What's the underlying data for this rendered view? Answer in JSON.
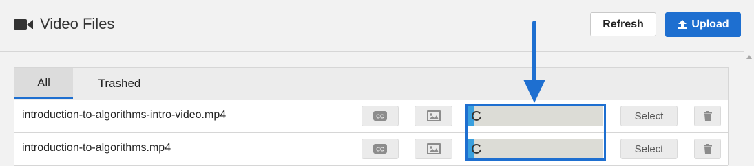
{
  "header": {
    "title": "Video Files",
    "refresh_label": "Refresh",
    "upload_label": "Upload",
    "title_icon": "video-camera-icon",
    "upload_icon": "upload-icon"
  },
  "tabs": [
    {
      "label": "All",
      "active": true
    },
    {
      "label": "Trashed",
      "active": false
    }
  ],
  "files": [
    {
      "name": "introduction-to-algorithms-intro-video.mp4",
      "progress_percent": 5,
      "select_label": "Select"
    },
    {
      "name": "introduction-to-algorithms.mp4",
      "progress_percent": 5,
      "select_label": "Select"
    }
  ],
  "row_icons": [
    "closed-captions-icon",
    "image-icon",
    "spinner-icon",
    "trash-icon"
  ],
  "colors": {
    "accent": "#1e6fd0",
    "progress_fill": "#3aa0de",
    "progress_track": "#dcdcd6"
  }
}
